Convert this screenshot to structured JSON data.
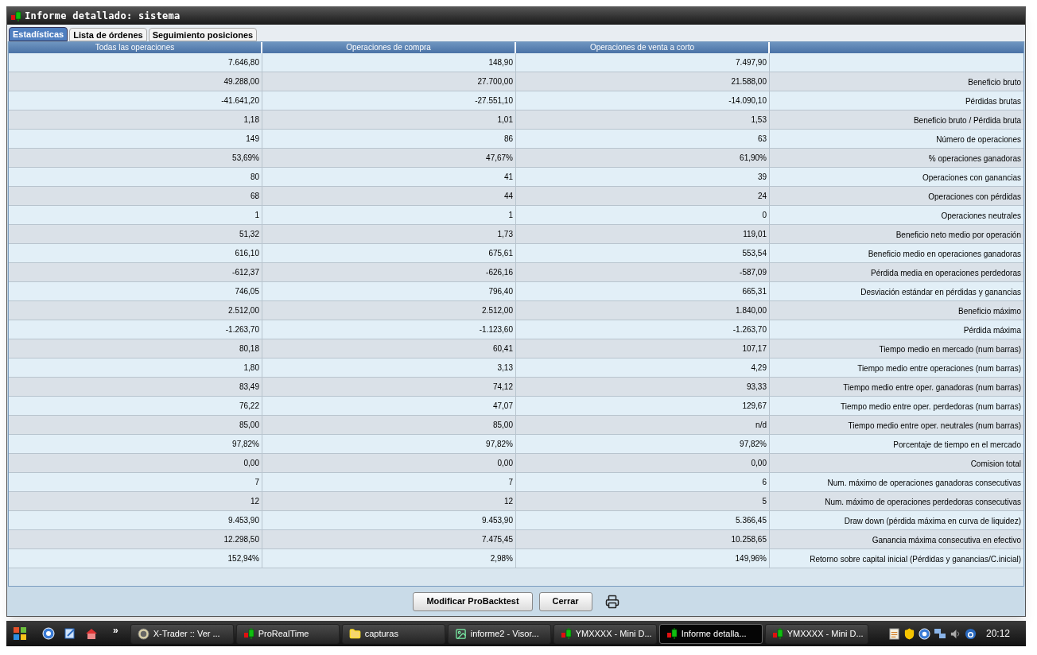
{
  "window": {
    "title": "Informe detallado: sistema"
  },
  "tabs": [
    {
      "label": "Estadísticas",
      "selected": true
    },
    {
      "label": "Lista de órdenes",
      "selected": false
    },
    {
      "label": "Seguimiento posiciones",
      "selected": false
    }
  ],
  "table": {
    "columns": [
      "Todas las operaciones",
      "Operaciones de compra",
      "Operaciones de venta a corto"
    ],
    "rows": [
      {
        "values": [
          "7.646,80",
          "148,90",
          "7.497,90"
        ]
      },
      {
        "values": [
          "49.288,00",
          "27.700,00",
          "21.588,00"
        ],
        "label": "Beneficio bruto"
      },
      {
        "values": [
          "-41.641,20",
          "-27.551,10",
          "-14.090,10"
        ],
        "label": "Pérdidas brutas"
      },
      {
        "values": [
          "1,18",
          "1,01",
          "1,53"
        ],
        "label": "Beneficio bruto / Pérdida bruta"
      },
      {
        "values": [
          "149",
          "86",
          "63"
        ],
        "label": "Número de operaciones"
      },
      {
        "values": [
          "53,69%",
          "47,67%",
          "61,90%"
        ],
        "label": "% operaciones ganadoras"
      },
      {
        "values": [
          "80",
          "41",
          "39"
        ],
        "label": "Operaciones con ganancias"
      },
      {
        "values": [
          "68",
          "44",
          "24"
        ],
        "label": "Operaciones con pérdidas"
      },
      {
        "values": [
          "1",
          "1",
          "0"
        ],
        "label": "Operaciones neutrales"
      },
      {
        "values": [
          "51,32",
          "1,73",
          "119,01"
        ],
        "label": "Beneficio neto medio por operación"
      },
      {
        "values": [
          "616,10",
          "675,61",
          "553,54"
        ],
        "label": "Beneficio medio en operaciones ganadoras"
      },
      {
        "values": [
          "-612,37",
          "-626,16",
          "-587,09"
        ],
        "label": "Pérdida media en operaciones perdedoras"
      },
      {
        "values": [
          "746,05",
          "796,40",
          "665,31"
        ],
        "label": "Desviación estándar en pérdidas y ganancias"
      },
      {
        "values": [
          "2.512,00",
          "2.512,00",
          "1.840,00"
        ],
        "label": "Beneficio máximo"
      },
      {
        "values": [
          "-1.263,70",
          "-1.123,60",
          "-1.263,70"
        ],
        "label": "Pérdida máxima"
      },
      {
        "values": [
          "80,18",
          "60,41",
          "107,17"
        ],
        "label": "Tiempo medio en mercado (num barras)"
      },
      {
        "values": [
          "1,80",
          "3,13",
          "4,29"
        ],
        "label": "Tiempo medio entre operaciones (num barras)"
      },
      {
        "values": [
          "83,49",
          "74,12",
          "93,33"
        ],
        "label": "Tiempo medio entre oper. ganadoras (num barras)"
      },
      {
        "values": [
          "76,22",
          "47,07",
          "129,67"
        ],
        "label": "Tiempo medio entre oper. perdedoras (num barras)"
      },
      {
        "values": [
          "85,00",
          "85,00",
          "n/d"
        ],
        "label": "Tiempo medio entre oper. neutrales (num barras)"
      },
      {
        "values": [
          "97,82%",
          "97,82%",
          "97,82%"
        ],
        "label": "Porcentaje de tiempo en el mercado"
      },
      {
        "values": [
          "0,00",
          "0,00",
          "0,00"
        ],
        "label": "Comision total"
      },
      {
        "values": [
          "7",
          "7",
          "6"
        ],
        "label": "Num. máximo de operaciones ganadoras consecutivas"
      },
      {
        "values": [
          "12",
          "12",
          "5"
        ],
        "label": "Num. máximo de operaciones perdedoras consecutivas"
      },
      {
        "values": [
          "9.453,90",
          "9.453,90",
          "5.366,45"
        ],
        "label": "Draw down (pérdida máxima en curva de liquidez)"
      },
      {
        "values": [
          "12.298,50",
          "7.475,45",
          "10.258,65"
        ],
        "label": "Ganancia máxima consecutiva en efectivo"
      },
      {
        "values": [
          "152,94%",
          "2,98%",
          "149,96%"
        ],
        "label": "Retorno sobre capital inicial (Pérdidas y ganancias/C.inicial)"
      }
    ]
  },
  "buttons": [
    "Modificar ProBacktest",
    "Cerrar"
  ],
  "taskbar": {
    "items": [
      {
        "label": "X-Trader :: Ver ...",
        "kind": "circle",
        "selected": false
      },
      {
        "label": "ProRealTime",
        "kind": "candles",
        "selected": false
      },
      {
        "label": "capturas",
        "kind": "folder",
        "selected": false
      },
      {
        "label": "informe2 - Visor...",
        "kind": "image",
        "selected": false
      },
      {
        "label": "YMXXXX - Mini D...",
        "kind": "candles",
        "selected": false
      },
      {
        "label": "Informe detalla...",
        "kind": "candles",
        "selected": true
      },
      {
        "label": "YMXXXX - Mini D...",
        "kind": "candles",
        "selected": false
      }
    ],
    "quick_launch_more": "»",
    "clock": "20:12"
  }
}
